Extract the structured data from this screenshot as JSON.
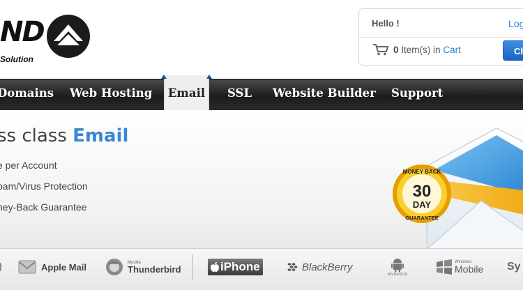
{
  "header": {
    "logo_letters": "ND",
    "logo_tagline": "Solution",
    "greeting": "Hello !",
    "login_link": "Log",
    "cart_count": "0",
    "cart_items_text": "Item(s) in",
    "cart_link": "Cart",
    "checkout_button": "Ch"
  },
  "nav": {
    "items": [
      {
        "label": "Domains"
      },
      {
        "label": "Web Hosting"
      },
      {
        "label": "Email"
      },
      {
        "label": "SSL"
      },
      {
        "label": "Website Builder"
      },
      {
        "label": "Support"
      }
    ],
    "active_index": 2
  },
  "hero": {
    "title_prefix": "ss class",
    "title_accent": "Email",
    "features": [
      "e per Account",
      "pam/Virus Protection",
      "ney-Back Guarantee"
    ],
    "badge": {
      "top": "MONEY BACK",
      "number": "30",
      "unit": "DAY",
      "bottom": "GUARANTEE"
    }
  },
  "clients": {
    "apple_mail": "Apple Mail",
    "thunderbird_small": "Mozilla",
    "thunderbird": "Thunderbird",
    "iphone": "iPhone",
    "blackberry": "BlackBerry",
    "android": "ANDROID",
    "windows_small": "Windows",
    "windows_mobile": "Mobile",
    "cut": "Sy"
  },
  "colors": {
    "accent": "#3a86d4",
    "link": "#2a7fd0",
    "badge_gold": "#f2b300",
    "nav_bg": "#2a2a2a"
  }
}
